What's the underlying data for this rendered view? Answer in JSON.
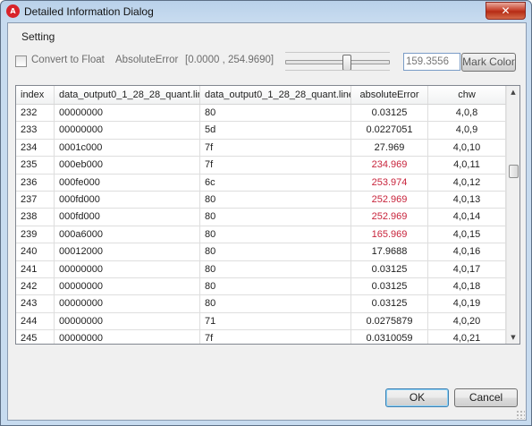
{
  "window": {
    "title": "Detailed Information Dialog",
    "icon": "app-logo-icon",
    "close_glyph": "✕"
  },
  "setting": {
    "group_title": "Setting",
    "convert_label": "Convert to Float",
    "convert_checked": false,
    "metric_label": "AbsoluteError",
    "range_text": "[0.0000 , 254.9690]",
    "slider_fraction": 0.6,
    "threshold_value": "159.3556",
    "mark_color_label": "Mark Color"
  },
  "table": {
    "columns": [
      "index",
      "data_output0_1_28_28_quant.lin...",
      "data_output0_1_28_28_quant.linear...",
      "absoluteError",
      "chw"
    ],
    "rows": [
      [
        "232",
        "00000000",
        "80",
        "0.03125",
        "4,0,8"
      ],
      [
        "233",
        "00000000",
        "5d",
        "0.0227051",
        "4,0,9"
      ],
      [
        "234",
        "0001c000",
        "7f",
        "27.969",
        "4,0,10"
      ],
      [
        "235",
        "000eb000",
        "7f",
        "234.969",
        "4,0,11"
      ],
      [
        "236",
        "000fe000",
        "6c",
        "253.974",
        "4,0,12"
      ],
      [
        "237",
        "000fd000",
        "80",
        "252.969",
        "4,0,13"
      ],
      [
        "238",
        "000fd000",
        "80",
        "252.969",
        "4,0,14"
      ],
      [
        "239",
        "000a6000",
        "80",
        "165.969",
        "4,0,15"
      ],
      [
        "240",
        "00012000",
        "80",
        "17.9688",
        "4,0,16"
      ],
      [
        "241",
        "00000000",
        "80",
        "0.03125",
        "4,0,17"
      ],
      [
        "242",
        "00000000",
        "80",
        "0.03125",
        "4,0,18"
      ],
      [
        "243",
        "00000000",
        "80",
        "0.03125",
        "4,0,19"
      ],
      [
        "244",
        "00000000",
        "71",
        "0.0275879",
        "4,0,20"
      ],
      [
        "245",
        "00000000",
        "7f",
        "0.0310059",
        "4,0,21"
      ]
    ],
    "highlight_color": "#c8243c",
    "scroll_up_glyph": "▲",
    "scroll_down_glyph": "▼"
  },
  "buttons": {
    "ok_label": "OK",
    "cancel_label": "Cancel"
  }
}
